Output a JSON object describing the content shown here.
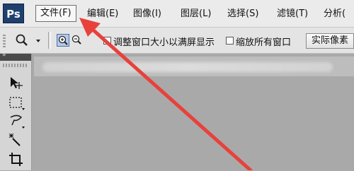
{
  "app": {
    "logo_text": "Ps"
  },
  "menu": {
    "items": [
      {
        "label": "文件(F)"
      },
      {
        "label": "编辑(E)"
      },
      {
        "label": "图像(I)"
      },
      {
        "label": "图层(L)"
      },
      {
        "label": "选择(S)"
      },
      {
        "label": "滤镜(T)"
      },
      {
        "label": "分析("
      }
    ],
    "active_index": 0
  },
  "options_bar": {
    "zoom_in_active": true,
    "resize_window_label": "调整窗口大小以满屏显示",
    "resize_window_checked": false,
    "zoom_all_windows_label": "缩放所有窗口",
    "zoom_all_windows_checked": false,
    "actual_pixels_button": "实际像素"
  },
  "toolbox": {
    "header_glyph": "»",
    "tools": [
      "move-tool-icon",
      "marquee-tool-icon",
      "lasso-tool-icon",
      "magic-wand-tool-icon",
      "crop-tool-icon"
    ]
  },
  "annotation": {
    "arrow_color": "#e8413b"
  }
}
